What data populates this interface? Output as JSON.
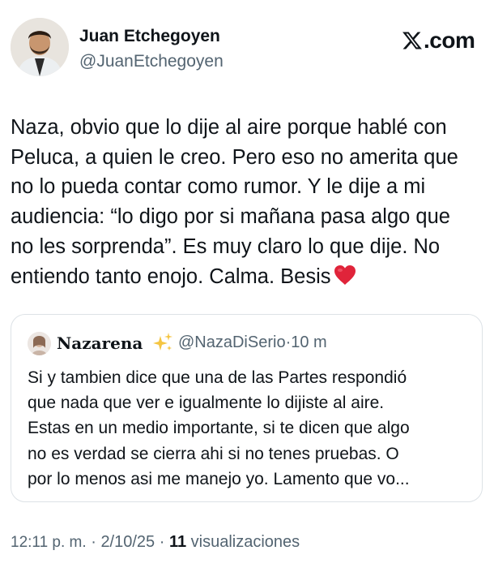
{
  "author": {
    "name": "Juan Etchegoyen",
    "handle": "@JuanEtchegoyen"
  },
  "brand": {
    "logo_text": ".com",
    "logo_icon": "x-logo-icon"
  },
  "tweet": {
    "lines": [
      "Naza, obvio que lo dije al aire porque hablé con",
      "Peluca, a quien le creo. Pero eso no amerita que",
      "no lo pueda contar como rumor. Y le dije a mi",
      "audiencia: “lo digo por si mañana pasa algo que",
      "no les sorprenda”. Es muy claro lo que dije. No",
      "entiendo tanto enojo. Calma. Besis"
    ],
    "emoji": "red-heart-icon"
  },
  "quote": {
    "name": "Nazarena",
    "sparkle": "sparkles-icon",
    "handle": "@NazaDiSerio",
    "separator": "·",
    "time": "10 m",
    "lines": [
      "Si y tambien dice que una de las Partes respondió",
      "que nada que ver e igualmente lo dijiste al aire.",
      "Estas en un medio importante, si te dicen que algo",
      "no es verdad se cierra ahi si no tenes pruebas. O",
      "por lo menos asi me manejo yo. Lamento que vo..."
    ]
  },
  "meta": {
    "time": "12:11 p. m.",
    "sep1": " · ",
    "date": "2/10/25",
    "sep2": " · ",
    "views_count": "11",
    "views_label": " visualizaciones"
  },
  "colors": {
    "text": "#0f1419",
    "secondary": "#536471",
    "border": "#dde2e6",
    "heart": "#e0243a",
    "sparkle": "#f5c542"
  }
}
